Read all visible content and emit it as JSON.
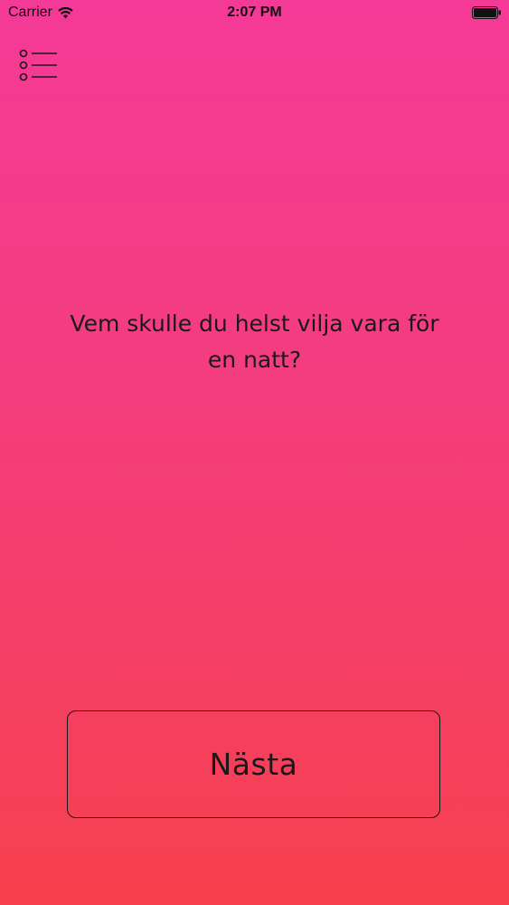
{
  "status_bar": {
    "carrier": "Carrier",
    "time": "2:07 PM",
    "wifi_icon": "wifi-icon",
    "battery_icon": "battery-icon",
    "battery_level": 1.0
  },
  "header": {
    "menu_icon": "list-menu-icon"
  },
  "main": {
    "question": "Vem skulle du helst vilja vara för en natt?"
  },
  "footer": {
    "next_label": "Nästa"
  },
  "colors": {
    "gradient_top": "#f43a97",
    "gradient_bottom": "#f6404d",
    "text": "#1a1a1a"
  }
}
